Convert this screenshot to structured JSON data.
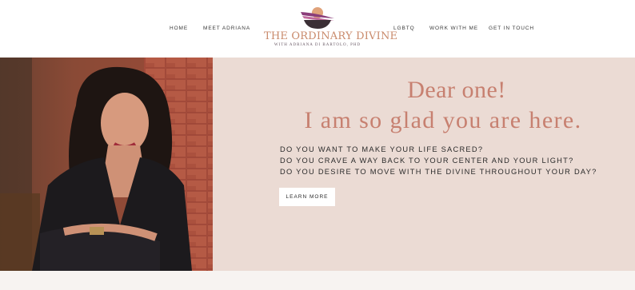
{
  "nav": {
    "left": [
      {
        "label": "HOME",
        "name": "nav-home"
      },
      {
        "label": "MEET ADRIANA",
        "name": "nav-meet-adriana"
      }
    ],
    "right": [
      {
        "label": "LGBTQ",
        "name": "nav-lgbtq"
      },
      {
        "label": "WORK WITH ME",
        "name": "nav-work-with-me"
      },
      {
        "label": "GET IN TOUCH",
        "name": "nav-get-in-touch"
      }
    ]
  },
  "logo": {
    "title": "THE ORDINARY DIVINE",
    "subtitle": "WITH ADRIANA DI BARTOLO, PHD",
    "colors": {
      "sun": "#e0a27a",
      "purple": "#8a3d7a",
      "magenta": "#c06a9c",
      "dark": "#3b2f35"
    }
  },
  "hero": {
    "greeting": "Dear one!",
    "welcome": "I am so glad you are here.",
    "questions": [
      "DO YOU WANT TO MAKE YOUR LIFE SACRED?",
      "DO YOU CRAVE A WAY BACK TO YOUR CENTER AND YOUR LIGHT?",
      "DO YOU DESIRE TO MOVE WITH THE DIVINE THROUGHOUT YOUR DAY?"
    ],
    "cta_label": "LEARN MORE",
    "colors": {
      "background": "#ebdbd4",
      "heading": "#c78070"
    }
  }
}
